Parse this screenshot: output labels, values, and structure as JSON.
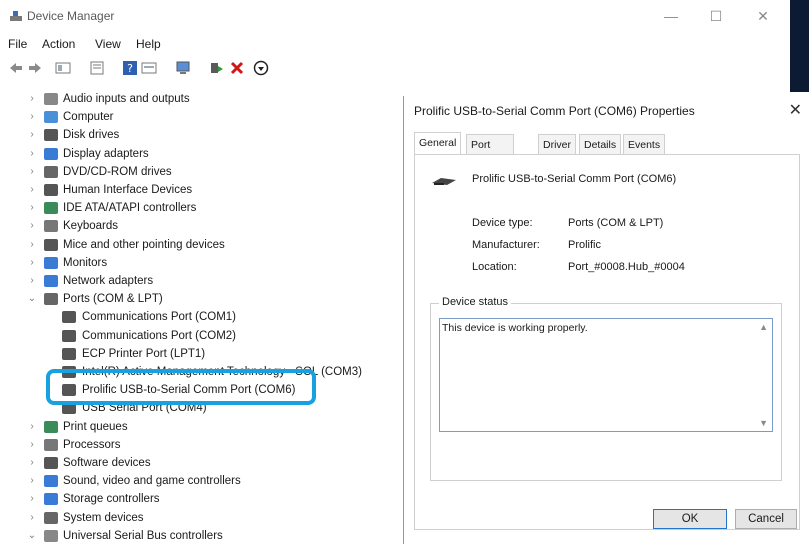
{
  "window": {
    "title": "Device Manager",
    "controls": [
      "—",
      "☐",
      "✕"
    ]
  },
  "menu": [
    "File",
    "Action",
    "View",
    "Help"
  ],
  "tree": {
    "items": [
      {
        "label": "Audio inputs and outputs",
        "expanded": false
      },
      {
        "label": "Computer",
        "expanded": false
      },
      {
        "label": "Disk drives",
        "expanded": false
      },
      {
        "label": "Display adapters",
        "expanded": false
      },
      {
        "label": "DVD/CD-ROM drives",
        "expanded": false
      },
      {
        "label": "Human Interface Devices",
        "expanded": false
      },
      {
        "label": "IDE ATA/ATAPI controllers",
        "expanded": false
      },
      {
        "label": "Keyboards",
        "expanded": false
      },
      {
        "label": "Mice and other pointing devices",
        "expanded": false
      },
      {
        "label": "Monitors",
        "expanded": false
      },
      {
        "label": "Network adapters",
        "expanded": false
      },
      {
        "label": "Ports (COM & LPT)",
        "expanded": true
      },
      {
        "label": "Communications Port (COM1)",
        "child": true
      },
      {
        "label": "Communications Port (COM2)",
        "child": true
      },
      {
        "label": "ECP Printer Port (LPT1)",
        "child": true
      },
      {
        "label": "Intel(R) Active Management Technology - SOL (COM3)",
        "child": true
      },
      {
        "label": "Prolific USB-to-Serial Comm Port (COM6)",
        "child": true,
        "selected": true
      },
      {
        "label": "USB Serial Port (COM4)",
        "child": true
      },
      {
        "label": "Print queues",
        "expanded": false
      },
      {
        "label": "Processors",
        "expanded": false
      },
      {
        "label": "Software devices",
        "expanded": false
      },
      {
        "label": "Sound, video and game controllers",
        "expanded": false
      },
      {
        "label": "Storage controllers",
        "expanded": false
      },
      {
        "label": "System devices",
        "expanded": false
      },
      {
        "label": "Universal Serial Bus controllers",
        "expanded": true
      }
    ]
  },
  "dialog": {
    "title": "Prolific USB-to-Serial Comm Port (COM6) Properties",
    "tabs": [
      "General",
      "Port Settings",
      "Driver",
      "Details",
      "Events"
    ],
    "device_name": "Prolific USB-to-Serial Comm Port (COM6)",
    "device_type_label": "Device type:",
    "device_type_value": "Ports (COM & LPT)",
    "manufacturer_label": "Manufacturer:",
    "manufacturer_value": "Prolific",
    "location_label": "Location:",
    "location_value": "Port_#0008.Hub_#0004",
    "status_group": "Device status",
    "status_text": "This device is working properly.",
    "ok": "OK",
    "cancel": "Cancel"
  },
  "colors": {
    "highlight": "#17a1e0",
    "accent": "#1e74d0"
  }
}
